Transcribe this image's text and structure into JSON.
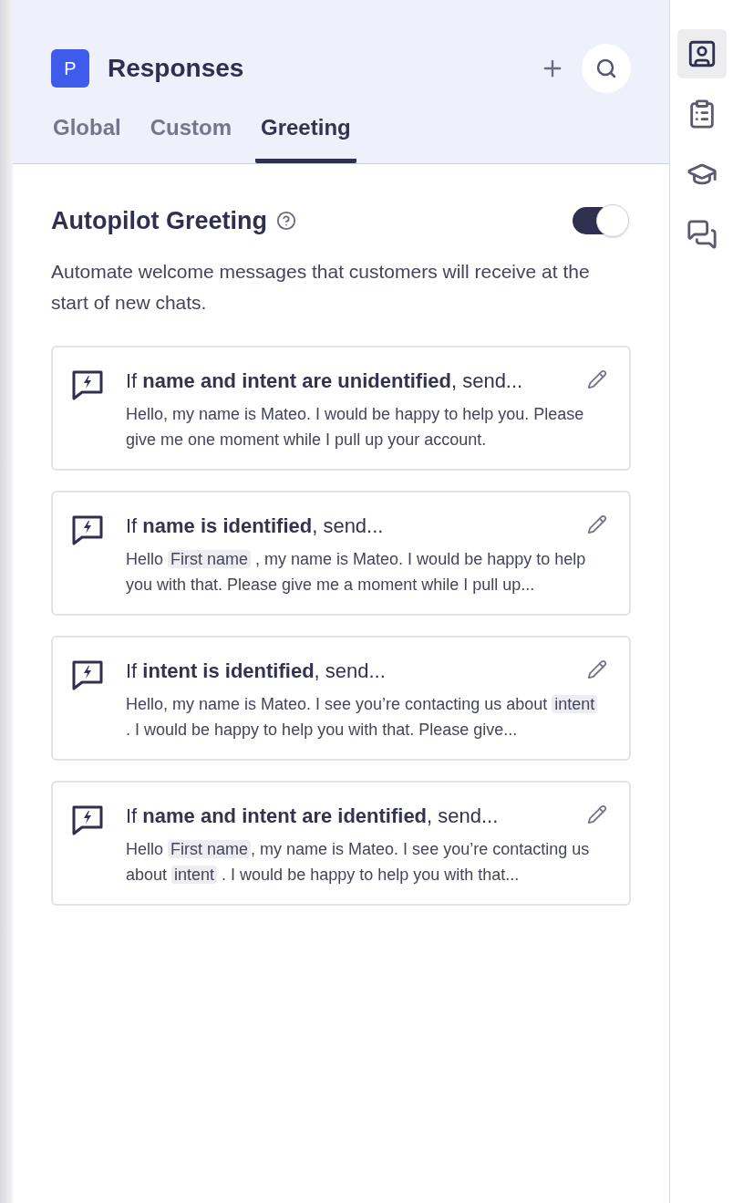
{
  "header": {
    "logo": "P",
    "title": "Responses"
  },
  "tabs": [
    {
      "label": "Global",
      "selected": false
    },
    {
      "label": "Custom",
      "selected": false
    },
    {
      "label": "Greeting",
      "selected": true
    }
  ],
  "section": {
    "title": "Autopilot Greeting",
    "on": true,
    "description": "Automate welcome messages that customers will receive at the start of new chats."
  },
  "greetings": [
    {
      "condition": "If **name and intent are unidentified**, send...",
      "message": [
        {
          "kind": "text",
          "text": "Hello, my name is Mateo. I would be happy to help you. Please give me one moment while I pull up your account."
        }
      ]
    },
    {
      "condition": "If **name is identified**, send...",
      "message": [
        {
          "kind": "text",
          "text": "Hello "
        },
        {
          "kind": "token",
          "text": "First name"
        },
        {
          "kind": "text",
          "text": " , my name is Mateo. I would be happy to help you with that. Please give me a moment while I pull up..."
        }
      ]
    },
    {
      "condition": "If **intent is identified**, send...",
      "message": [
        {
          "kind": "text",
          "text": "Hello, my name is Mateo. I see you’re contacting us about "
        },
        {
          "kind": "token",
          "text": "intent"
        },
        {
          "kind": "text",
          "text": " . I would be happy to help you with that. Please give..."
        }
      ]
    },
    {
      "condition": "If **name and intent are identified**, send...",
      "message": [
        {
          "kind": "text",
          "text": "Hello "
        },
        {
          "kind": "token",
          "text": "First name"
        },
        {
          "kind": "text",
          "text": ", my name is Mateo. I see you’re contacting us about "
        },
        {
          "kind": "token",
          "text": "intent"
        },
        {
          "kind": "text",
          "text": " . I would be happy to help you with that..."
        }
      ]
    }
  ],
  "sidebar": [
    {
      "kind": "contact",
      "selected": true
    },
    {
      "kind": "clipboard",
      "selected": false
    },
    {
      "kind": "graduation",
      "selected": false
    },
    {
      "kind": "chat",
      "selected": false
    }
  ]
}
